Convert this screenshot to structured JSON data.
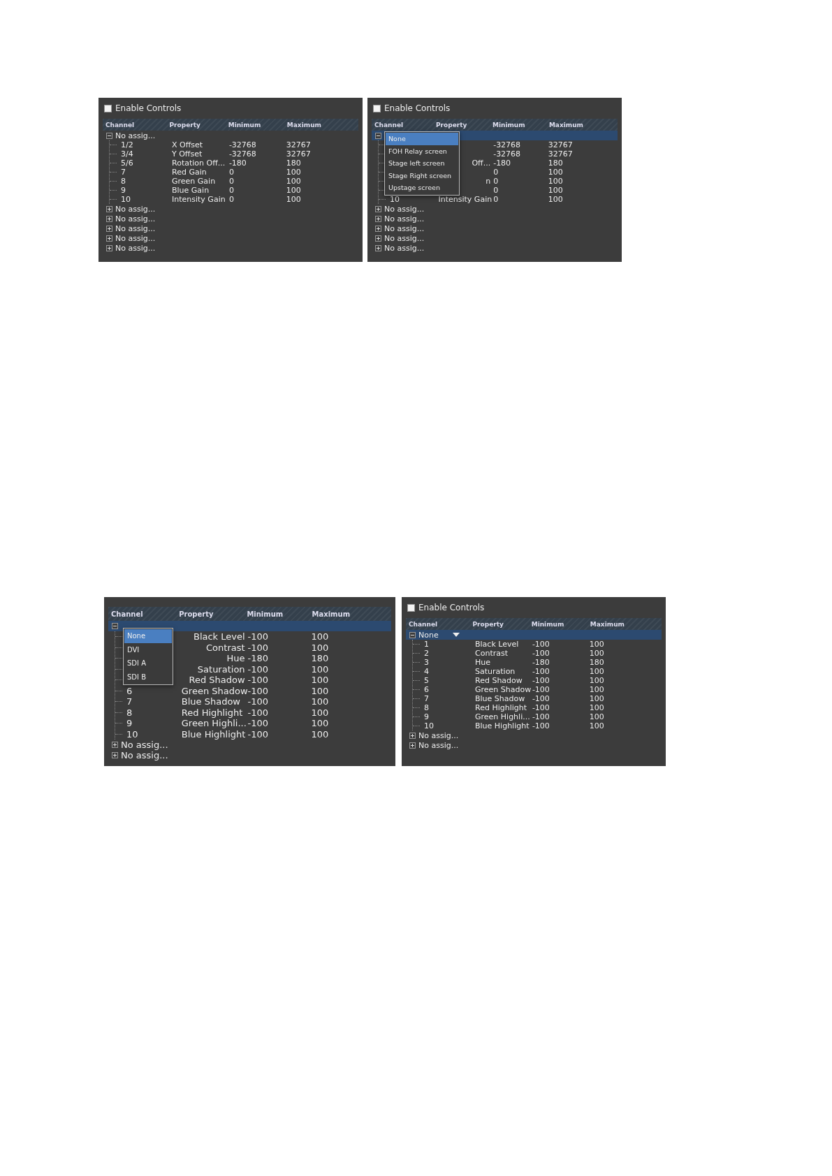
{
  "panels": [
    {
      "enable_controls": {
        "label": "Enable Controls",
        "checked": false
      },
      "columns": [
        "Channel",
        "Property",
        "Minimum",
        "Maximum"
      ],
      "groups": [
        {
          "label": "No assig...",
          "expanded": true,
          "selected": false,
          "children": [
            {
              "channel": "1/2",
              "property": "X Offset",
              "minimum": "-32768",
              "maximum": "32767"
            },
            {
              "channel": "3/4",
              "property": "Y Offset",
              "minimum": "-32768",
              "maximum": "32767"
            },
            {
              "channel": "5/6",
              "property": "Rotation Off...",
              "minimum": "-180",
              "maximum": "180"
            },
            {
              "channel": "7",
              "property": "Red Gain",
              "minimum": "0",
              "maximum": "100"
            },
            {
              "channel": "8",
              "property": "Green Gain",
              "minimum": "0",
              "maximum": "100"
            },
            {
              "channel": "9",
              "property": "Blue Gain",
              "minimum": "0",
              "maximum": "100"
            },
            {
              "channel": "10",
              "property": "Intensity Gain",
              "minimum": "0",
              "maximum": "100"
            }
          ]
        },
        {
          "label": "No assig...",
          "expanded": false,
          "selected": false
        },
        {
          "label": "No assig...",
          "expanded": false,
          "selected": false
        },
        {
          "label": "No assig...",
          "expanded": false,
          "selected": false
        },
        {
          "label": "No assig...",
          "expanded": false,
          "selected": false
        },
        {
          "label": "No assig...",
          "expanded": false,
          "selected": false
        }
      ]
    },
    {
      "enable_controls": {
        "label": "Enable Controls",
        "checked": false
      },
      "columns": [
        "Channel",
        "Property",
        "Minimum",
        "Maximum"
      ],
      "groups": [
        {
          "expanded": true,
          "selected": true,
          "children": [
            {
              "minimum": "-32768",
              "maximum": "32767"
            },
            {
              "minimum": "-32768",
              "maximum": "32767"
            },
            {
              "property": "Off...",
              "minimum": "-180",
              "maximum": "180"
            },
            {
              "minimum": "0",
              "maximum": "100"
            },
            {
              "property": "n",
              "minimum": "0",
              "maximum": "100"
            },
            {
              "minimum": "0",
              "maximum": "100"
            },
            {
              "channel": "10",
              "property": "Intensity Gain",
              "minimum": "0",
              "maximum": "100"
            }
          ]
        },
        {
          "label": "No assig...",
          "expanded": false,
          "selected": false
        },
        {
          "label": "No assig...",
          "expanded": false,
          "selected": false
        },
        {
          "label": "No assig...",
          "expanded": false,
          "selected": false
        },
        {
          "label": "No assig...",
          "expanded": false,
          "selected": false
        },
        {
          "label": "No assig...",
          "expanded": false,
          "selected": false
        }
      ],
      "dropdown": {
        "items": [
          {
            "label": "None",
            "selected": true
          },
          {
            "label": "FOH Relay screen",
            "selected": false
          },
          {
            "label": "Stage left screen",
            "selected": false
          },
          {
            "label": "Stage Right screen",
            "selected": false
          },
          {
            "label": "Upstage screen",
            "selected": false
          }
        ]
      }
    },
    {
      "columns": [
        "Channel",
        "Property",
        "Minimum",
        "Maximum"
      ],
      "groups": [
        {
          "expanded": true,
          "selected": true,
          "children": [
            {
              "property": "Black Level",
              "minimum": "-100",
              "maximum": "100"
            },
            {
              "property": "Contrast",
              "minimum": "-100",
              "maximum": "100"
            },
            {
              "property": "Hue",
              "minimum": "-180",
              "maximum": "180"
            },
            {
              "property": "Saturation",
              "minimum": "-100",
              "maximum": "100"
            },
            {
              "property": "Red Shadow",
              "minimum": "-100",
              "maximum": "100"
            },
            {
              "channel": "6",
              "property": "Green Shadow",
              "minimum": "-100",
              "maximum": "100"
            },
            {
              "channel": "7",
              "property": "Blue Shadow",
              "minimum": "-100",
              "maximum": "100"
            },
            {
              "channel": "8",
              "property": "Red Highlight",
              "minimum": "-100",
              "maximum": "100"
            },
            {
              "channel": "9",
              "property": "Green Highli...",
              "minimum": "-100",
              "maximum": "100"
            },
            {
              "channel": "10",
              "property": "Blue Highlight",
              "minimum": "-100",
              "maximum": "100"
            }
          ]
        },
        {
          "label": "No assig...",
          "expanded": false,
          "selected": false
        },
        {
          "label": "No assig...",
          "expanded": false,
          "selected": false
        }
      ],
      "dropdown": {
        "items": [
          {
            "label": "None",
            "selected": true
          },
          {
            "label": "DVI",
            "selected": false
          },
          {
            "label": "SDI A",
            "selected": false
          },
          {
            "label": "SDI B",
            "selected": false
          }
        ]
      }
    },
    {
      "enable_controls": {
        "label": "Enable Controls",
        "checked": false
      },
      "columns": [
        "Channel",
        "Property",
        "Minimum",
        "Maximum"
      ],
      "groups": [
        {
          "label": "None",
          "expanded": true,
          "selected": true,
          "editing": true,
          "children": [
            {
              "channel": "1",
              "property": "Black Level",
              "minimum": "-100",
              "maximum": "100"
            },
            {
              "channel": "2",
              "property": "Contrast",
              "minimum": "-100",
              "maximum": "100"
            },
            {
              "channel": "3",
              "property": "Hue",
              "minimum": "-180",
              "maximum": "180"
            },
            {
              "channel": "4",
              "property": "Saturation",
              "minimum": "-100",
              "maximum": "100"
            },
            {
              "channel": "5",
              "property": "Red Shadow",
              "minimum": "-100",
              "maximum": "100"
            },
            {
              "channel": "6",
              "property": "Green Shadow",
              "minimum": "-100",
              "maximum": "100"
            },
            {
              "channel": "7",
              "property": "Blue Shadow",
              "minimum": "-100",
              "maximum": "100"
            },
            {
              "channel": "8",
              "property": "Red Highlight",
              "minimum": "-100",
              "maximum": "100"
            },
            {
              "channel": "9",
              "property": "Green Highli...",
              "minimum": "-100",
              "maximum": "100"
            },
            {
              "channel": "10",
              "property": "Blue Highlight",
              "minimum": "-100",
              "maximum": "100"
            }
          ]
        },
        {
          "label": "No assig...",
          "expanded": false,
          "selected": false
        },
        {
          "label": "No assig...",
          "expanded": false,
          "selected": false
        }
      ]
    }
  ]
}
